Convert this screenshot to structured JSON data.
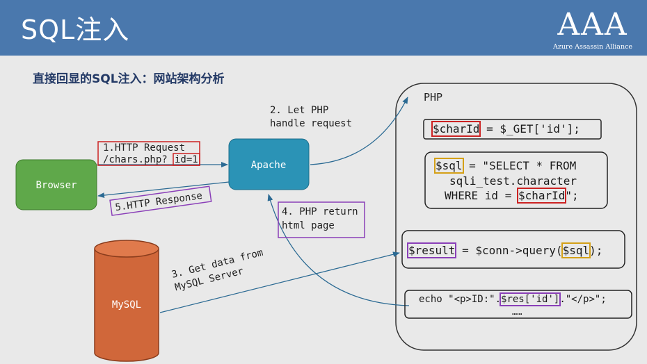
{
  "header": {
    "title": "SQL注入",
    "logo_text": "AAA",
    "logo_subtitle": "Azure Assassin Alliance"
  },
  "subtitle": "直接回显的SQL注入：网站架构分析",
  "nodes": {
    "browser": "Browser",
    "apache": "Apache",
    "mysql": "MySQL",
    "php": "PHP"
  },
  "steps": {
    "request_line1": "1.HTTP Request",
    "request_line2": "/chars.php?",
    "request_param": "id=1",
    "php_handle_line1": "2. Let PHP",
    "php_handle_line2": "handle request",
    "mysql_line1": "3. Get data from",
    "mysql_line2": "MySQL Server",
    "php_return_line1": "4. PHP return",
    "php_return_line2": "html page",
    "response": "5.HTTP Response"
  },
  "code": {
    "line1_var": "$charId",
    "line1_rest": " = $_GET['id'];",
    "line2_var": "$sql",
    "line2_rest": " = \"SELECT * FROM",
    "line2b": "sqli_test.character",
    "line2c_pre": "WHERE id = ",
    "line2c_var": "$charId",
    "line2c_post": "\";",
    "line3_var": "$result",
    "line3_mid": " = $conn->query(",
    "line3_arg": "$sql",
    "line3_post": ");",
    "line4_pre": "echo \"<p>ID:\".",
    "line4_var": "$res['id']",
    "line4_post": ".\"</p>\";",
    "line4_more": "……"
  },
  "colors": {
    "header": "#4a78ad",
    "browser": "#5fa84a",
    "apache": "#2b93b6",
    "mysql": "#d0673a",
    "highlight_red": "#cc2222",
    "highlight_yellow": "#d4a017",
    "highlight_purple": "#8a3fb8",
    "arrow": "#2b6a93"
  }
}
